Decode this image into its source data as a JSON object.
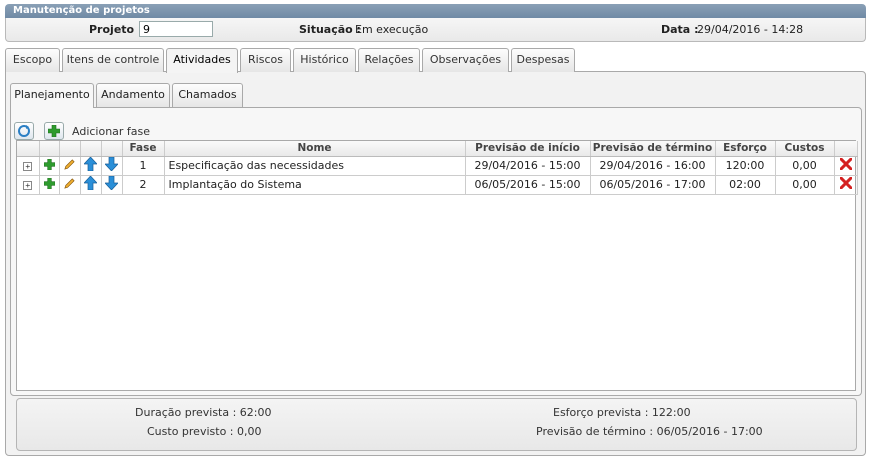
{
  "window": {
    "title": "Manutenção de projetos"
  },
  "header": {
    "project_label": "Projeto :",
    "project_value": "9",
    "status_label": "Situação :",
    "status_value": "Em execução",
    "date_label": "Data :",
    "date_value": "29/04/2016 - 14:28"
  },
  "tabs": [
    "Escopo",
    "Itens de controle",
    "Atividades",
    "Riscos",
    "Histórico",
    "Relações",
    "Observações",
    "Despesas"
  ],
  "active_tab": "Atividades",
  "subtabs": [
    "Planejamento",
    "Andamento",
    "Chamados"
  ],
  "active_subtab": "Planejamento",
  "toolbar": {
    "add_phase_label": "Adicionar fase"
  },
  "grid": {
    "columns": [
      "Fase",
      "Nome",
      "Previsão de início",
      "Previsão de término",
      "Esforço",
      "Custos"
    ],
    "rows": [
      {
        "phase": "1",
        "name": "Especificação das necessidades",
        "start": "29/04/2016 - 15:00",
        "end": "29/04/2016 - 16:00",
        "effort": "120:00",
        "cost": "0,00"
      },
      {
        "phase": "2",
        "name": "Implantação do Sistema",
        "start": "06/05/2016 - 15:00",
        "end": "06/05/2016 - 17:00",
        "effort": "02:00",
        "cost": "0,00"
      }
    ]
  },
  "summary": {
    "duration": "Duração prevista : 62:00",
    "effort": "Esforço prevista : 122:00",
    "cost": "Custo previsto : 0,00",
    "end": "Previsão de término : 06/05/2016 - 17:00"
  },
  "colors": {
    "title_bar": "#7f97ae",
    "add_green": "#2e9b2e",
    "arrow_blue": "#2a8fd8",
    "delete_red": "#d42020"
  },
  "icons": [
    "refresh-icon",
    "plus-icon",
    "expand-icon",
    "pencil-icon",
    "arrow-up-icon",
    "arrow-down-icon",
    "delete-icon"
  ]
}
